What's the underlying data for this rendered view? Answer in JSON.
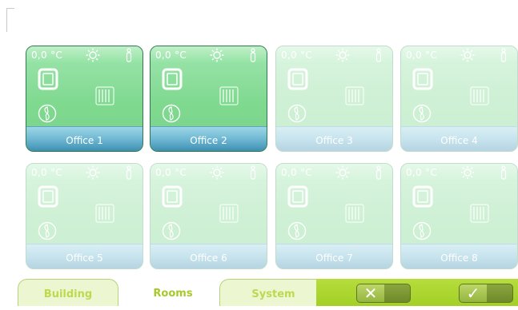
{
  "rooms": [
    {
      "name": "Office 1",
      "temperature": "0,0 °C",
      "active": true
    },
    {
      "name": "Office 2",
      "temperature": "0,0 °C",
      "active": true
    },
    {
      "name": "Office 3",
      "temperature": "0,0 °C",
      "active": false
    },
    {
      "name": "Office 4",
      "temperature": "0,0 °C",
      "active": false
    },
    {
      "name": "Office 5",
      "temperature": "0,0 °C",
      "active": false
    },
    {
      "name": "Office 6",
      "temperature": "0,0 °C",
      "active": false
    },
    {
      "name": "Office 7",
      "temperature": "0,0 °C",
      "active": false
    },
    {
      "name": "Office 8",
      "temperature": "0,0 °C",
      "active": false
    }
  ],
  "tile_icons": [
    "sun-icon",
    "person-icon",
    "window-icon",
    "radiator-icon",
    "fan-icon"
  ],
  "tabs": [
    {
      "label": "Building",
      "selected": false
    },
    {
      "label": "Rooms",
      "selected": true
    },
    {
      "label": "System",
      "selected": false
    }
  ],
  "actions": {
    "cancel_glyph": "✕",
    "confirm_glyph": "✓"
  },
  "colors": {
    "tile_green": "#7fd98f",
    "name_bar_blue": "#6fb8d3",
    "tab_text": "#bdd94f",
    "action_green": "#a3cf26"
  }
}
